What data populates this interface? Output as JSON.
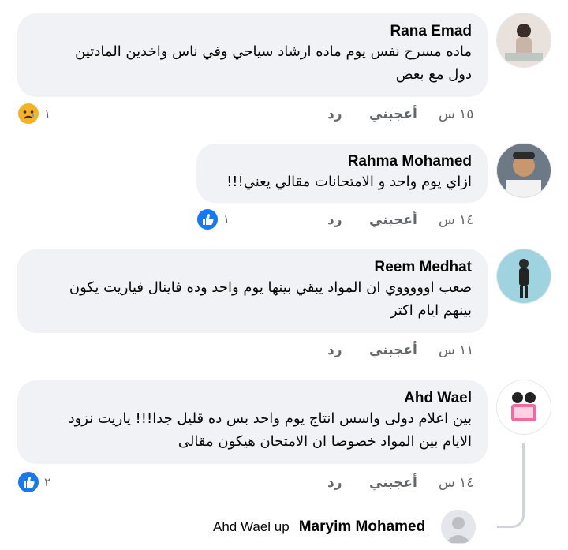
{
  "comments": [
    {
      "author": "Rana Emad",
      "lines": [
        "ماده مسرح نفس يوم ماده ارشاد سياحي وفي ناس واخدين المادتين",
        "دول مع بعض"
      ],
      "time": "١٥ س",
      "like_label": "أعجبني",
      "reply_label": "رد",
      "reaction": {
        "type": "sad-icon",
        "count": "١"
      }
    },
    {
      "author": "Rahma Mohamed",
      "lines": [
        "ازاي يوم واحد و الامتحانات مقالي يعني!!!"
      ],
      "time": "١٤ س",
      "like_label": "أعجبني",
      "reply_label": "رد",
      "reaction": {
        "type": "like-icon",
        "count": "١"
      }
    },
    {
      "author": "Reem Medhat",
      "lines": [
        "صعب اوووووي ان المواد يبقي بينها يوم واحد وده فاينال فياريت يكون",
        "بينهم ايام اكتر"
      ],
      "time": "١١ س",
      "like_label": "أعجبني",
      "reply_label": "رد",
      "reaction": null
    },
    {
      "author": "Ahd Wael",
      "lines": [
        "بين اعلام دولى واسس انتاج يوم واحد بس ده قليل جدا!!! ياريت نزود",
        "الايام بين المواد خصوصا ان الامتحان هيكون مقالى"
      ],
      "time": "١٤ س",
      "like_label": "أعجبني",
      "reply_label": "رد",
      "reaction": {
        "type": "like-icon",
        "count": "٢"
      }
    }
  ],
  "reply_preview": {
    "name": "Maryim Mohamed",
    "text": "Ahd Wael up"
  },
  "colors": {
    "bubble": "#f0f2f5",
    "meta_text": "#65676b",
    "like_blue": "#1877f2",
    "sad_yellow": "#f7b125"
  }
}
